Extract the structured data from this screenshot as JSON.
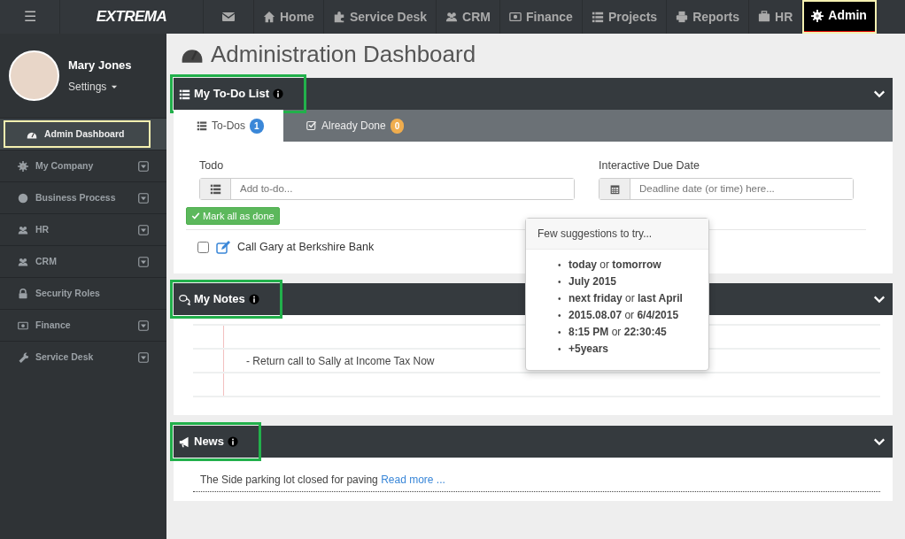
{
  "topbar": {
    "menu_glyph": "☰",
    "logo": "EXTREMA",
    "nav": [
      {
        "label": "Home",
        "selected": false
      },
      {
        "label": "Service Desk",
        "selected": false
      },
      {
        "label": "CRM",
        "selected": false
      },
      {
        "label": "Finance",
        "selected": false
      },
      {
        "label": "Projects",
        "selected": false
      },
      {
        "label": "Reports",
        "selected": false
      },
      {
        "label": "HR",
        "selected": false
      },
      {
        "label": "Admin",
        "selected": true
      }
    ]
  },
  "sidebar": {
    "user": {
      "name": "Mary Jones",
      "menu": "Settings"
    },
    "items": [
      {
        "label": "Admin Dashboard",
        "expandable": false,
        "selected": true
      },
      {
        "label": "My Company",
        "expandable": true,
        "selected": false
      },
      {
        "label": "Business Process",
        "expandable": true,
        "selected": false
      },
      {
        "label": "HR",
        "expandable": true,
        "selected": false
      },
      {
        "label": "CRM",
        "expandable": true,
        "selected": false
      },
      {
        "label": "Security Roles",
        "expandable": false,
        "selected": false
      },
      {
        "label": "Finance",
        "expandable": true,
        "selected": false
      },
      {
        "label": "Service Desk",
        "expandable": true,
        "selected": false
      }
    ]
  },
  "page_title": "Administration Dashboard",
  "todo_panel": {
    "title": "My To-Do List",
    "highlighted": true,
    "tabs": [
      {
        "label": "To-Dos",
        "count": "1",
        "selected": true
      },
      {
        "label": "Already Done",
        "count": "0",
        "selected": false
      }
    ],
    "todo_label": "Todo",
    "todo_placeholder": "Add to-do...",
    "due_label": "Interactive Due Date",
    "due_placeholder": "Deadline date (or time) here...",
    "mark_all": "Mark all as done",
    "items": [
      {
        "text": "Call Gary at Berkshire Bank",
        "checked": false
      }
    ],
    "suggestions": {
      "title": "Few suggestions to try...",
      "bullet": "•",
      "items": [
        "**today** or **tomorrow**",
        "**July 2015**",
        "**next friday** or **last April**",
        "**2015.08.07** or **6/4/2015**",
        "**8:15 PM** or **22:30:45**",
        "**+5years**"
      ]
    }
  },
  "notes_panel": {
    "title": "My Notes",
    "highlighted": true,
    "lines": [
      "- Return call to Sally at Income Tax Now"
    ]
  },
  "news_panel": {
    "title": "News",
    "highlighted": true,
    "text": "The Side parking lot closed for paving",
    "link": "Read more ..."
  }
}
